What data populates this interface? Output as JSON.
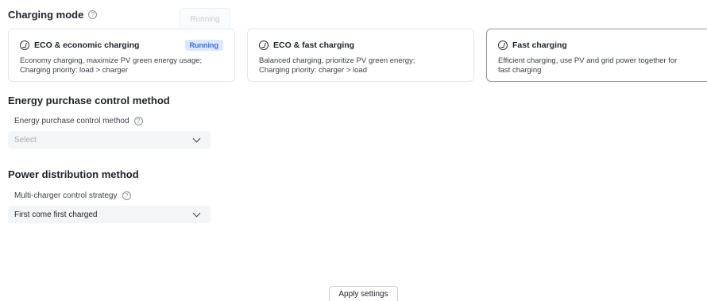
{
  "charging_mode": {
    "title": "Charging mode",
    "help": "?",
    "ghost_tag": "Running",
    "cards": [
      {
        "title": "ECO & economic charging",
        "badge": "Running",
        "desc": [
          "Economy charging, maximize PV green energy usage;",
          "Charging priority: load > charger"
        ]
      },
      {
        "title": "ECO & fast charging",
        "desc": [
          "Balanced charging, prioritize PV green energy;",
          "Charging priority: charger > load"
        ]
      },
      {
        "title": "Fast charging",
        "desc": [
          "Efficient charging, use PV and grid power together for",
          "fast charging"
        ]
      }
    ]
  },
  "energy_purchase": {
    "title": "Energy purchase control method",
    "field_label": "Energy purchase control method",
    "help": "?",
    "placeholder": "Select"
  },
  "power_distribution": {
    "title": "Power distribution method",
    "field_label": "Multi-charger control strategy",
    "help": "?",
    "value": "First come first charged"
  },
  "apply_button": "Apply settings"
}
